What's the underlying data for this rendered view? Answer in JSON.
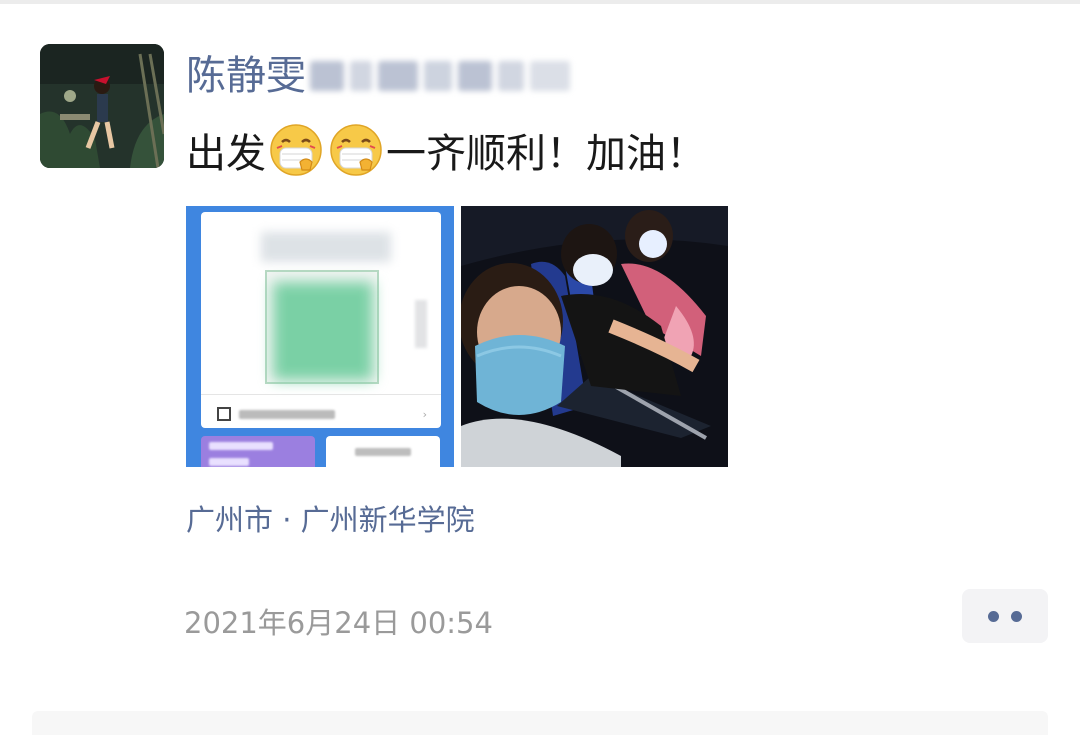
{
  "post": {
    "author": "陈静雯",
    "text_before": "出发",
    "text_after": "一齐顺利！加油！",
    "emoji": [
      "face-with-medical-mask-emoji",
      "face-with-medical-mask-emoji"
    ],
    "location": "广州市 · 广州新华学院",
    "timestamp": "2021年6月24日 00:54"
  },
  "colors": {
    "link": "#576b95",
    "text": "#191919",
    "meta": "#9a9a9a"
  }
}
